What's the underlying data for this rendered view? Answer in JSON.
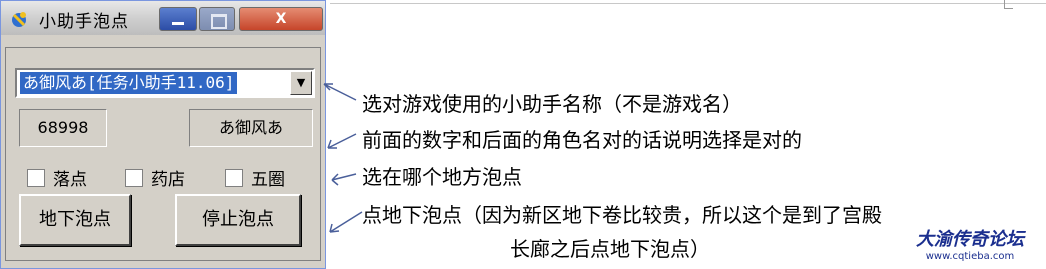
{
  "window": {
    "title": "小助手泡点",
    "close_label": "X"
  },
  "form": {
    "helper_select": {
      "value": "あ御风あ[任务小助手11.06]",
      "arrow": "▼"
    },
    "number_display": "68998",
    "character_name": "あ御风あ",
    "checkboxes": [
      {
        "label": "落点",
        "checked": false
      },
      {
        "label": "药店",
        "checked": false
      },
      {
        "label": "五圈",
        "checked": false
      }
    ],
    "buttons": {
      "dig_label": "地下泡点",
      "stop_label": "停止泡点"
    }
  },
  "annotations": [
    "选对游戏使用的小助手名称（不是游戏名）",
    "前面的数字和后面的角色名对的话说明选择是对的",
    "选在哪个地方泡点",
    "点地下泡点（因为新区地下卷比较贵，所以这个是到了宫殿",
    "长廊之后点地下泡点）"
  ],
  "watermark": {
    "title": "大渝传奇论坛",
    "url": "www.cqtieba.com"
  }
}
